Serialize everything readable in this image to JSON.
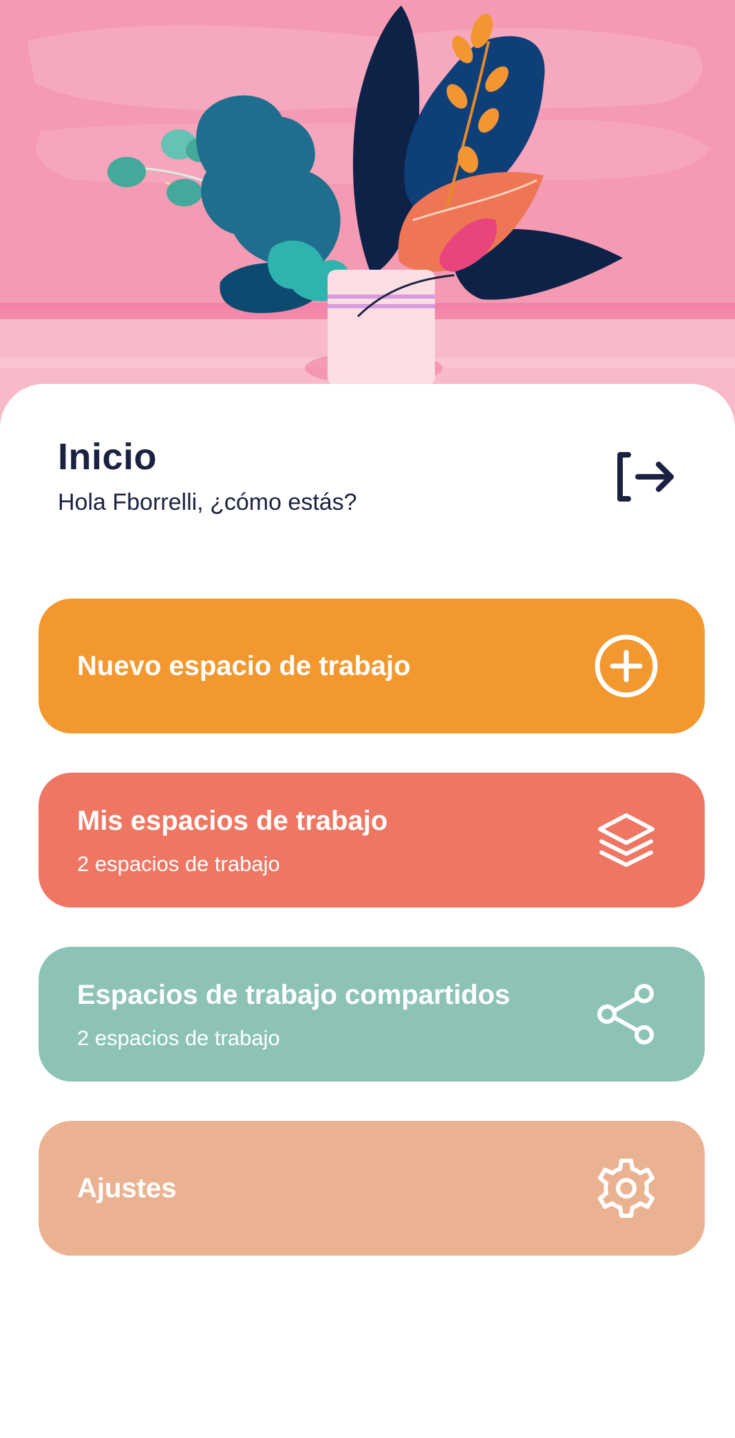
{
  "header": {
    "title": "Inicio",
    "greeting": "Hola Fborrelli, ¿cómo estás?"
  },
  "icons": {
    "logout": "logout-icon",
    "new": "plus-circle-icon",
    "mine": "layers-icon",
    "shared": "share-icon",
    "settings": "gear-icon"
  },
  "cards": [
    {
      "title": "Nuevo espacio de trabajo",
      "subtitle": "",
      "color": "#F2982E"
    },
    {
      "title": "Mis espacios de trabajo",
      "subtitle": "2 espacios de trabajo",
      "color": "#EE7663"
    },
    {
      "title": "Espacios de trabajo compartidos",
      "subtitle": "2 espacios de trabajo",
      "color": "#8DC3B7"
    },
    {
      "title": "Ajustes",
      "subtitle": "",
      "color": "#EBB292"
    }
  ],
  "colors": {
    "hero_background": "#F49AB3",
    "hero_floor": "#F8BAC9",
    "text_dark": "#1B2140"
  }
}
